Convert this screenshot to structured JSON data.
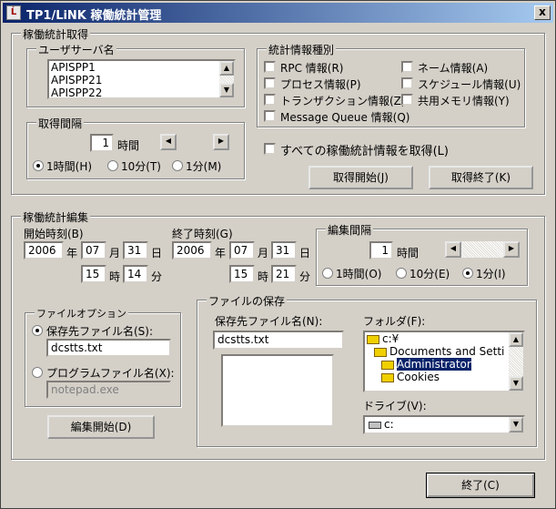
{
  "window": {
    "title": "TP1/LiNK 稼働統計管理",
    "close": "x"
  },
  "acquire": {
    "legend": "稼働統計取得",
    "user_server": {
      "legend": "ユーザサーバ名",
      "items": [
        "APISPP1",
        "APISPP21",
        "APISPP22"
      ]
    },
    "interval": {
      "legend": "取得間隔",
      "value": "1",
      "unit": "時間",
      "opt_1h": "1時間(H)",
      "opt_10m": "10分(T)",
      "opt_1m": "1分(M)",
      "selected": "1時間(H)"
    },
    "types": {
      "legend": "統計情報種別",
      "rpc": "RPC 情報(R)",
      "name": "ネーム情報(A)",
      "process": "プロセス情報(P)",
      "schedule": "スケジュール情報(U)",
      "transaction": "トランザクション情報(Z)",
      "shared_mem": "共用メモリ情報(Y)",
      "mq": "Message Queue 情報(Q)"
    },
    "all_check": "すべての稼働統計情報を取得(L)",
    "start_btn": "取得開始(J)",
    "stop_btn": "取得終了(K)"
  },
  "edit": {
    "legend": "稼働統計編集",
    "start_label": "開始時刻(B)",
    "end_label": "終了時刻(G)",
    "start": {
      "year": "2006",
      "month": "07",
      "day": "31",
      "hour": "15",
      "min": "14"
    },
    "end": {
      "year": "2006",
      "month": "07",
      "day": "31",
      "hour": "15",
      "min": "21"
    },
    "units": {
      "year": "年",
      "month": "月",
      "day": "日",
      "hour": "時",
      "min": "分"
    },
    "interval": {
      "legend": "編集間隔",
      "value": "1",
      "unit": "時間",
      "opt_1h": "1時間(O)",
      "opt_10m": "10分(E)",
      "opt_1m": "1分(I)",
      "selected": "1分(I)"
    },
    "file_opt": {
      "legend": "ファイルオプション",
      "save_label": "保存先ファイル名(S):",
      "save_value": "dcstts.txt",
      "prog_label": "プログラムファイル名(X):",
      "prog_value": "notepad.exe",
      "selected": "保存先ファイル名(S):"
    },
    "edit_btn": "編集開始(D)",
    "save": {
      "legend": "ファイルの保存",
      "filename_label": "保存先ファイル名(N):",
      "filename_value": "dcstts.txt",
      "folder_label": "フォルダ(F):",
      "folders": [
        "c:¥",
        "Documents and Setti",
        "Administrator",
        "Cookies"
      ],
      "drive_label": "ドライブ(V):",
      "drive_value": "c:"
    }
  },
  "exit_btn": "終了(C)"
}
